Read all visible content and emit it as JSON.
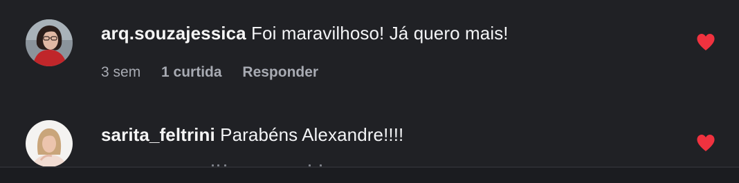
{
  "comments": [
    {
      "username": "arq.souzajessica",
      "text": "Foi maravilhoso! Já quero mais!",
      "time": "3 sem",
      "likes": "1 curtida",
      "reply": "Responder",
      "liked": true,
      "avatar_icon": "user-avatar-photo"
    },
    {
      "username": "sarita_feltrini",
      "text": "Parabéns Alexandre!!!!",
      "liked": true,
      "avatar_icon": "user-avatar-photo"
    }
  ],
  "colors": {
    "background": "#202125",
    "heart": "#f0323f",
    "text": "#f3f4f6",
    "meta": "#a8abb3"
  }
}
